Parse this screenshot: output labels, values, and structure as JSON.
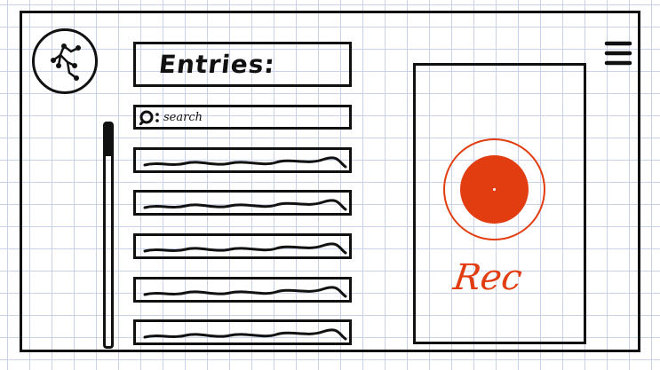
{
  "header": {
    "title": "Entries:"
  },
  "search": {
    "placeholder": "search"
  },
  "list": {
    "items": [
      "",
      "",
      "",
      "",
      ""
    ]
  },
  "recorder": {
    "label": "Rec"
  },
  "colors": {
    "ink": "#111111",
    "accent": "#e23d10",
    "grid": "#c9d2ea",
    "paper": "#ffffff"
  },
  "icons": {
    "logo": "node-tree-icon",
    "menu": "hamburger-menu-icon",
    "search": "magnifier-icon",
    "record": "record-icon"
  }
}
